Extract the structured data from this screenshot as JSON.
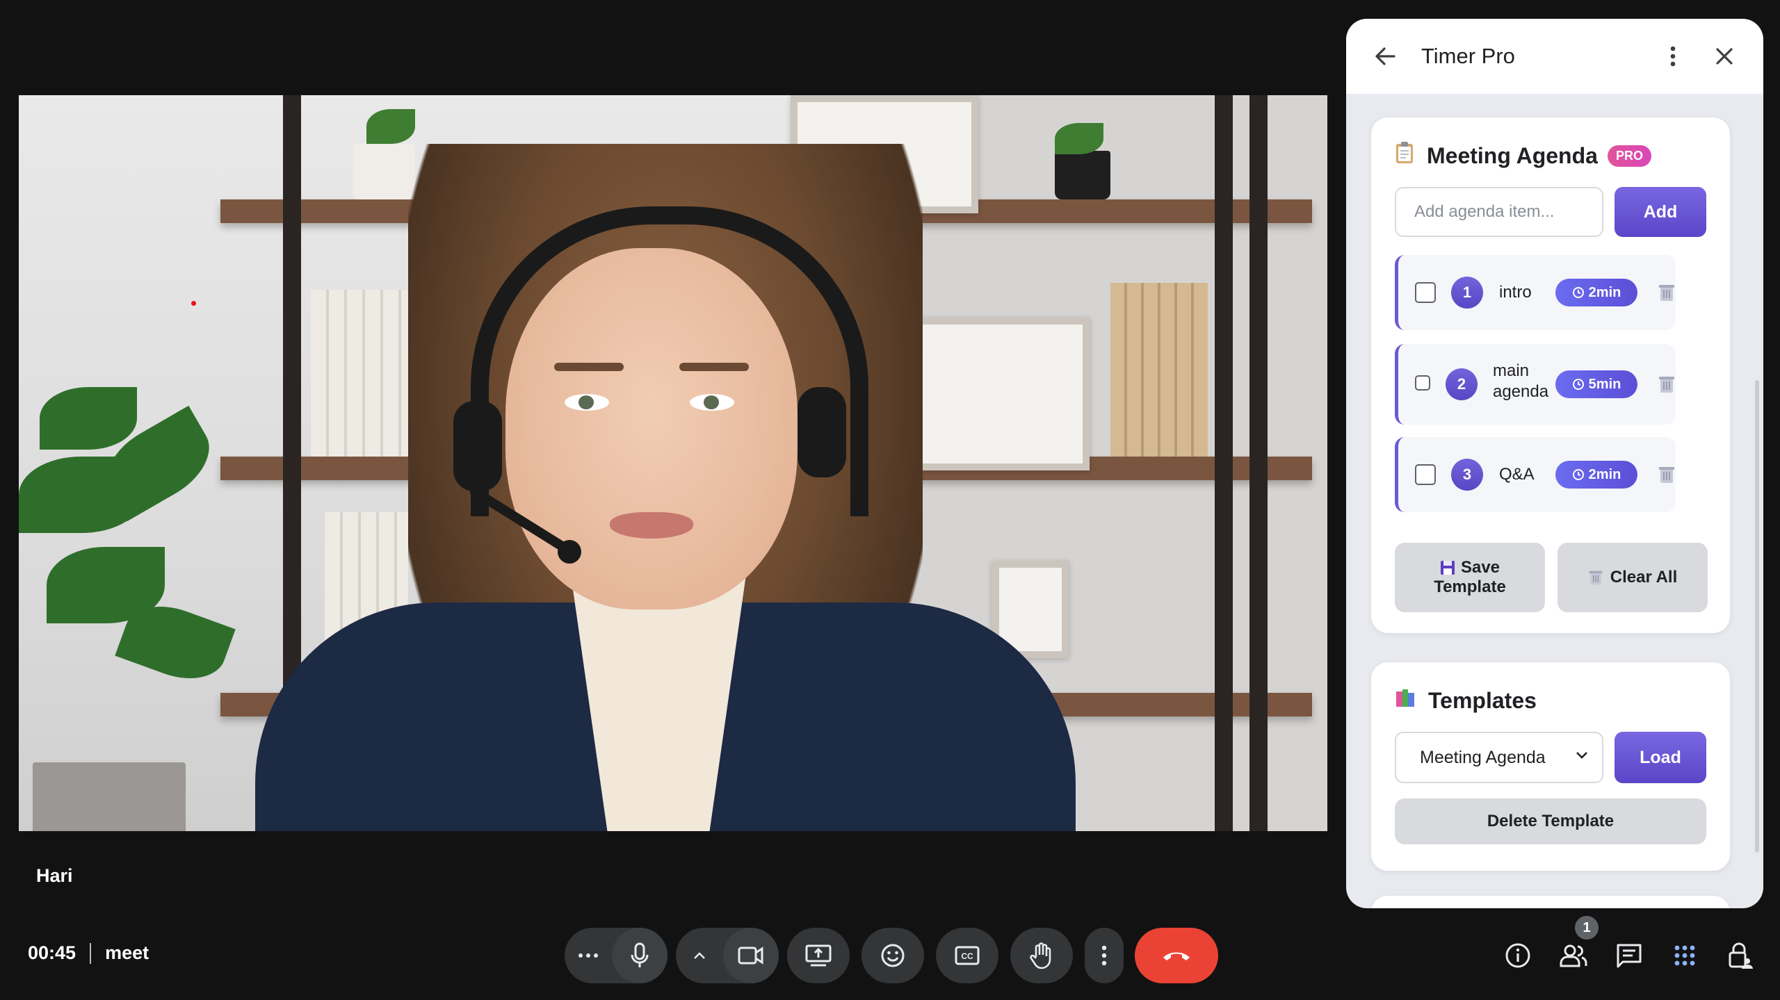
{
  "participant": {
    "name": "Hari"
  },
  "meeting": {
    "time": "00:45",
    "code": "meet"
  },
  "people_badge": "1",
  "panel": {
    "title": "Timer Pro",
    "agenda": {
      "title": "Meeting Agenda",
      "icon": "clipboard-icon",
      "badge": "PRO",
      "input_placeholder": "Add agenda item...",
      "add_label": "Add",
      "items": [
        {
          "number": "1",
          "label": "intro",
          "duration": "2min"
        },
        {
          "number": "2",
          "label_line1": "main",
          "label_line2": "agenda",
          "duration": "5min"
        },
        {
          "number": "3",
          "label": "Q&A",
          "duration": "2min"
        }
      ],
      "save_line1": "Save",
      "save_line2": "Template",
      "clear_label": "Clear All"
    },
    "templates": {
      "title": "Templates",
      "icon": "books-icon",
      "selected": "Meeting Agenda",
      "load_label": "Load",
      "delete_label": "Delete Template"
    }
  },
  "colors": {
    "accent": "#5a46c8",
    "hangup": "#ea4335",
    "pro_badge": "#e0559a",
    "background": "#121212"
  }
}
